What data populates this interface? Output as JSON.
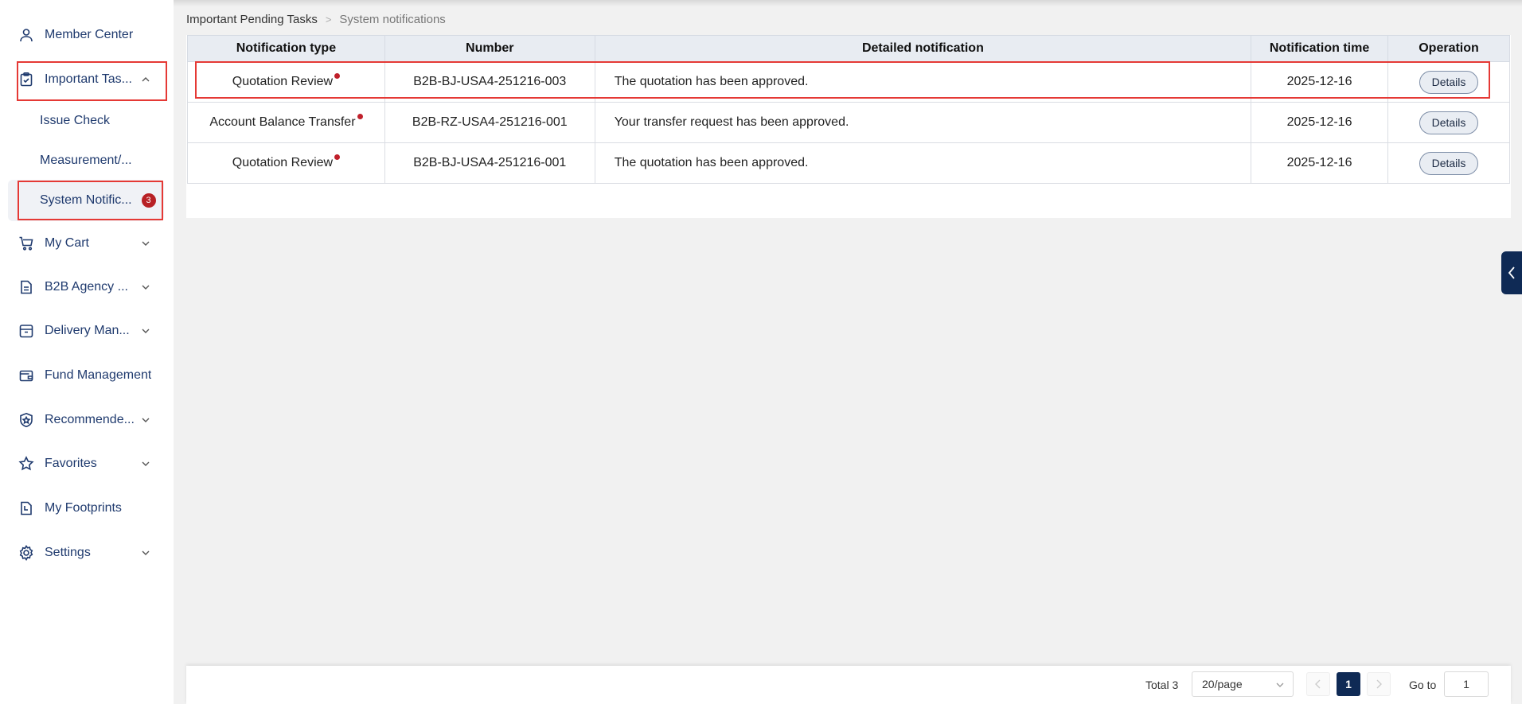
{
  "sidebar": {
    "items": [
      {
        "label": "Member Center",
        "icon": "user-icon"
      },
      {
        "label": "Important Tas...",
        "icon": "clipboard-check-icon"
      },
      {
        "label": "My Cart",
        "icon": "cart-icon"
      },
      {
        "label": "B2B Agency ...",
        "icon": "document-icon"
      },
      {
        "label": "Delivery Man...",
        "icon": "box-icon"
      },
      {
        "label": "Fund Management",
        "icon": "wallet-icon"
      },
      {
        "label": "Recommende...",
        "icon": "shield-star-icon"
      },
      {
        "label": "Favorites",
        "icon": "star-icon"
      },
      {
        "label": "My Footprints",
        "icon": "footprint-icon"
      },
      {
        "label": "Settings",
        "icon": "gear-icon"
      }
    ],
    "sub_items": [
      {
        "label": "Issue Check"
      },
      {
        "label": "Measurement/..."
      },
      {
        "label": "System Notific...",
        "badge": "3"
      }
    ]
  },
  "breadcrumb": {
    "parent": "Important Pending Tasks",
    "current": "System notifications"
  },
  "table": {
    "headers": [
      "Notification type",
      "Number",
      "Detailed notification",
      "Notification time",
      "Operation"
    ],
    "rows": [
      {
        "type": "Quotation Review",
        "number": "B2B-BJ-USA4-251216-003",
        "detail": "The quotation has been approved.",
        "time": "2025-12-16",
        "action": "Details"
      },
      {
        "type": "Account Balance Transfer",
        "number": "B2B-RZ-USA4-251216-001",
        "detail": "Your transfer request has been approved.",
        "time": "2025-12-16",
        "action": "Details"
      },
      {
        "type": "Quotation Review",
        "number": "B2B-BJ-USA4-251216-001",
        "detail": "The quotation has been approved.",
        "time": "2025-12-16",
        "action": "Details"
      }
    ]
  },
  "pagination": {
    "total": "Total 3",
    "page_size": "20/page",
    "current_page": "1",
    "goto_label": "Go to",
    "goto_value": "1"
  },
  "colors": {
    "accent": "#0f2a55",
    "highlight": "#e53935",
    "badge": "#b82125"
  }
}
